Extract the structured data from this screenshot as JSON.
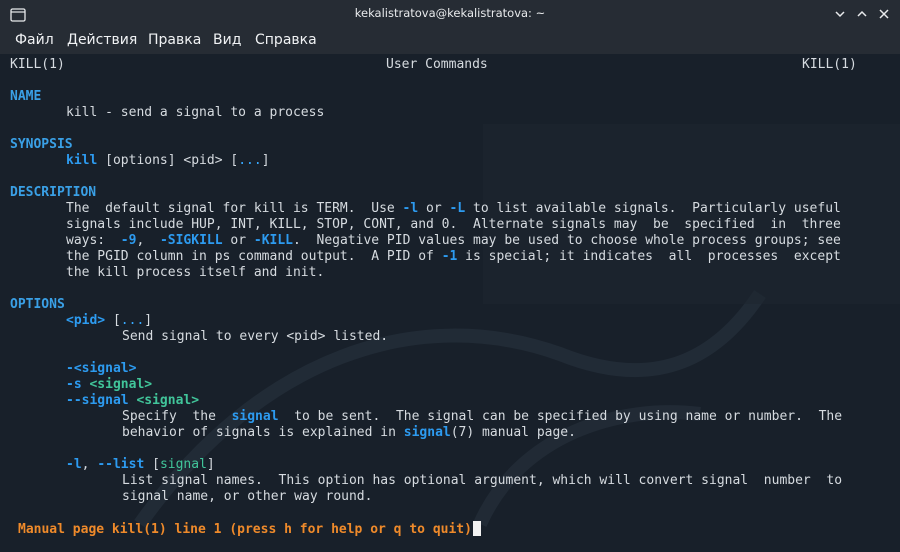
{
  "window": {
    "title": "kekalistratova@kekalistratova: ~"
  },
  "menu": {
    "file": "Файл",
    "actions": "Действия",
    "edit": "Правка",
    "view": "Вид",
    "help": "Справка"
  },
  "man": {
    "header_left": "KILL(1)",
    "header_center": "User Commands",
    "header_right": "KILL(1)",
    "name_heading": "NAME",
    "name_text": "kill - send a signal to a process",
    "synopsis_heading": "SYNOPSIS",
    "synopsis_cmd": "kill",
    "synopsis_args_pre": " [options] <pid> [",
    "synopsis_ellipsis": "...",
    "synopsis_args_post": "]",
    "description_heading": "DESCRIPTION",
    "desc_l1_a": "The  default signal for kill is TERM.  Use ",
    "desc_l1_opt1": "-l",
    "desc_l1_b": " or ",
    "desc_l1_opt2": "-L",
    "desc_l1_c": " to list available signals.  Particularly useful",
    "desc_l2": "signals include HUP, INT, KILL, STOP, CONT, and 0.  Alternate signals may  be  specified  in  three",
    "desc_l3_a": "ways:  ",
    "desc_l3_opt1": "-9",
    "desc_l3_b": ",  ",
    "desc_l3_opt2": "-SIGKILL",
    "desc_l3_c": " or ",
    "desc_l3_opt3": "-KILL",
    "desc_l3_d": ".  Negative PID values may be used to choose whole process groups; see",
    "desc_l4_a": "the PGID column in ps command output.  A PID of ",
    "desc_l4_opt": "-1",
    "desc_l4_b": " is special; it indicates  all  processes  except",
    "desc_l5": "the kill process itself and init.",
    "options_heading": "OPTIONS",
    "opt1_pid": "<pid>",
    "opt1_rest_a": " [",
    "opt1_ellipsis": "...",
    "opt1_rest_b": "]",
    "opt1_desc": "Send signal to every <pid> listed.",
    "opt2_a": "-<signal>",
    "opt2_b_flag": "-s",
    "opt2_b_arg": " <signal>",
    "opt2_c_flag": "--signal",
    "opt2_c_arg": " <signal>",
    "opt2_desc1_a": "Specify  the  ",
    "opt2_desc1_sig": "signal",
    "opt2_desc1_b": "  to be sent.  The signal can be specified by using name or number.  The",
    "opt2_desc2_a": "behavior of signals is explained in ",
    "opt2_desc2_ref": "signal",
    "opt2_desc2_b": "(7) manual page.",
    "opt3_flag1": "-l",
    "opt3_sep": ", ",
    "opt3_flag2": "--list",
    "opt3_arg_a": " [",
    "opt3_arg": "signal",
    "opt3_arg_b": "]",
    "opt3_desc1": "List signal names.  This option has optional argument, which will convert signal  number  to",
    "opt3_desc2": "signal name, or other way round."
  },
  "status": {
    "text": "Manual page kill(1) line 1 (press h for help or q to quit)"
  },
  "colors": {
    "background": "#18202a",
    "heading": "#3aa0e6",
    "option": "#2d9bf0",
    "argument": "#41c59a",
    "status": "#ef8a2a"
  }
}
